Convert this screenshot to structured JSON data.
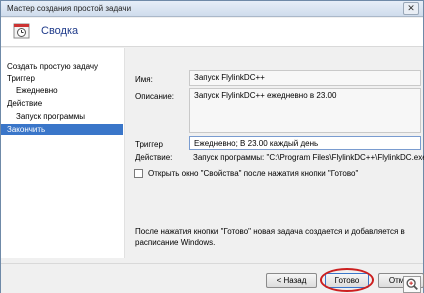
{
  "window": {
    "title": "Мастер создания простой задачи",
    "close_glyph": "✕"
  },
  "header": {
    "title": "Сводка",
    "icon": "task-scheduler-icon"
  },
  "sidebar": {
    "items": [
      {
        "label": "Создать простую задачу"
      },
      {
        "label": "Триггер"
      },
      {
        "label": "Ежедневно"
      },
      {
        "label": "Действие"
      },
      {
        "label": "Запуск программы"
      },
      {
        "label": "Закончить"
      }
    ]
  },
  "summary": {
    "name_label": "Имя:",
    "name_value": "Запуск FlylinkDC++",
    "description_label": "Описание:",
    "description_value": "Запуск FlylinkDC++ ежедневно в 23.00",
    "trigger_label": "Триггер",
    "trigger_value": "Ежедневно; В 23.00 каждый день",
    "action_label": "Действие:",
    "action_value": "Запуск программы: \"C:\\Program Files\\FlylinkDC++\\FlylinkDC.exe\"",
    "open_properties_label": "Открыть окно \"Свойства\" после нажатия кнопки \"Готово\"",
    "note": "После нажатия кнопки \"Готово\" новая задача создается и добавляется в расписание Windows."
  },
  "footer": {
    "back_label": "< Назад",
    "done_label": "Готово",
    "cancel_label": "Отмен"
  },
  "colors": {
    "accent": "#3a76c9",
    "highlight": "#cc1f1f",
    "header_text": "#1e3a8a"
  }
}
